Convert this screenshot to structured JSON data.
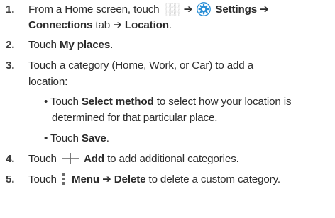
{
  "steps": [
    {
      "number": "1.",
      "line1": {
        "pre": "From a Home screen, touch",
        "arrow1": "➔",
        "settings_label": "Settings",
        "arrow2": "➔"
      },
      "line2": {
        "connections": "Connections",
        "tab_text": "tab",
        "arrow": "➔",
        "location": "Location",
        "end": "."
      }
    },
    {
      "number": "2.",
      "pre": "Touch",
      "bold": "My places",
      "end": "."
    },
    {
      "number": "3.",
      "line1": "Touch a category (Home, Work, or Car) to add a",
      "line2": "location:",
      "bullets": [
        {
          "symbol": "•",
          "pre": "Touch",
          "bold": "Select method",
          "post": "to select how your location is",
          "cont": "determined for that particular place."
        },
        {
          "symbol": "•",
          "pre": "Touch",
          "bold": "Save",
          "end": "."
        }
      ]
    },
    {
      "number": "4.",
      "pre": "Touch",
      "bold": "Add",
      "post": "to add additional categories."
    },
    {
      "number": "5.",
      "pre": "Touch",
      "bold_menu": "Menu",
      "arrow": "➔",
      "bold_delete": "Delete",
      "post": "to delete a custom category."
    }
  ],
  "icons": {
    "apps": "apps-grid-icon",
    "settings": "settings-gear-icon",
    "add": "plus-icon",
    "menu": "menu-vertical-icon"
  },
  "colors": {
    "settings_icon": "#2a8fd6",
    "text": "#2d2d2d"
  }
}
